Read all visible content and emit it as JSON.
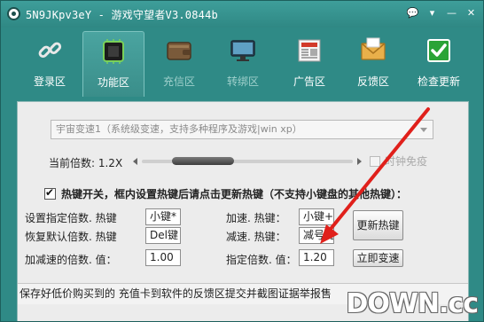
{
  "window": {
    "title": "5N9JKpv3eY - 游戏守望者V3.0844b"
  },
  "toolbar": {
    "items": [
      {
        "label": "登录区",
        "icon": "link-icon",
        "state": "normal"
      },
      {
        "label": "功能区",
        "icon": "chip-icon",
        "state": "active"
      },
      {
        "label": "充信区",
        "icon": "wallet-icon",
        "state": "disabled"
      },
      {
        "label": "转绑区",
        "icon": "monitor-icon",
        "state": "disabled"
      },
      {
        "label": "广告区",
        "icon": "newspaper-icon",
        "state": "normal"
      },
      {
        "label": "反馈区",
        "icon": "mail-icon",
        "state": "normal"
      },
      {
        "label": "检查更新",
        "icon": "check-icon",
        "state": "normal"
      }
    ]
  },
  "main": {
    "engine_select": "宇宙变速1（系统级变速，支持多种程序及游戏|win xp）",
    "current_speed_label": "当前倍数: 1.2X",
    "speed_slider": {
      "value_fraction": 0.2
    },
    "time_immunity_label": "时钟免疫",
    "hotkey_toggle_label": "热键开关，框内设置热键后请点击更新热键（不支持小键盘的其他热键）：",
    "hotkey_toggle_checked": true,
    "set_multiplier_hotkey": {
      "label": "设置指定倍数. 热键",
      "value": "小键*"
    },
    "reset_multiplier_hotkey": {
      "label": "恢复默认倍数. 热键",
      "value": "Del键"
    },
    "step_value": {
      "label": "加减速的倍数. 值：",
      "value": "1.00"
    },
    "speedup_hotkey": {
      "label": "加速. 热键：",
      "value": "小键+"
    },
    "slowdown_hotkey": {
      "label": "减速. 热键：",
      "value": "减号键"
    },
    "target_multiplier": {
      "label": "指定倍数. 值：",
      "value": "1.20"
    },
    "update_hotkey_button": "更新热键",
    "apply_speed_button": "立即变速",
    "notice": "保存好低价购买到的    充值卡到软件的反馈区提交并截图证据举报售"
  },
  "watermark": {
    "text": "DOWN.cc"
  },
  "colors": {
    "window_bg": "#2f8a86",
    "panel_bg": "#ececec",
    "arrow": "#e0201b"
  }
}
